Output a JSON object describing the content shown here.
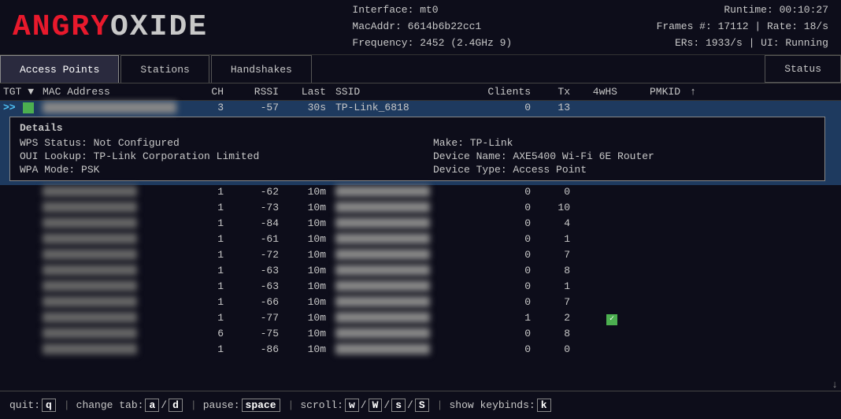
{
  "header": {
    "logo_angry": "ANGRY",
    "logo_oxide": "OXIDE",
    "interface_label": "Interface: mt0",
    "macaddr_label": "MacAddr: 6614b6b22cc1",
    "frequency_label": "Frequency: 2452 (2.4GHz 9)",
    "runtime_label": "Runtime: 00:10:27",
    "frames_label": "Frames #: 17112 | Rate: 18/s",
    "ers_label": "ERs: 1933/s | UI: Running"
  },
  "tabs": [
    {
      "id": "access-points",
      "label": "Access Points",
      "active": true
    },
    {
      "id": "stations",
      "label": "Stations",
      "active": false
    },
    {
      "id": "handshakes",
      "label": "Handshakes",
      "active": false
    },
    {
      "id": "status",
      "label": "Status",
      "active": false
    }
  ],
  "table": {
    "columns": [
      "TGT ▼",
      "MAC Address",
      "CH",
      "RSSI",
      "Last",
      "SSID",
      "Clients",
      "Tx",
      "4wHS",
      "PMKID"
    ],
    "scroll_up": "↑",
    "scroll_down": "↓",
    "selected_row": {
      "indicator": ">>",
      "check": "✓",
      "mac": "██████████",
      "ch": "3",
      "rssi": "-57",
      "last": "30s",
      "ssid": "TP-Link_6818",
      "clients": "0",
      "tx": "13",
      "4whs": "",
      "pmkid": ""
    },
    "details": {
      "title": "Details",
      "wps_status": "WPS Status: Not Configured",
      "oui_lookup": "OUI Lookup: TP-Link Corporation Limited",
      "wpa_mode": "WPA Mode: PSK",
      "make": "Make: TP-Link",
      "device_name": "Device Name: AXE5400 Wi-Fi 6E Router",
      "device_type": "Device Type: Access Point"
    },
    "rows": [
      {
        "ch": "1",
        "rssi": "-62",
        "last": "10m",
        "ssid": "blurred",
        "clients": "0",
        "tx": "0",
        "4whs": "",
        "pmkid": ""
      },
      {
        "ch": "1",
        "rssi": "-73",
        "last": "10m",
        "ssid": "blurred",
        "clients": "0",
        "tx": "10",
        "4whs": "",
        "pmkid": ""
      },
      {
        "ch": "1",
        "rssi": "-84",
        "last": "10m",
        "ssid": "blurred",
        "clients": "0",
        "tx": "4",
        "4whs": "",
        "pmkid": ""
      },
      {
        "ch": "1",
        "rssi": "-61",
        "last": "10m",
        "ssid": "blurred",
        "clients": "0",
        "tx": "1",
        "4whs": "",
        "pmkid": ""
      },
      {
        "ch": "1",
        "rssi": "-72",
        "last": "10m",
        "ssid": "blurred",
        "clients": "0",
        "tx": "7",
        "4whs": "",
        "pmkid": ""
      },
      {
        "ch": "1",
        "rssi": "-63",
        "last": "10m",
        "ssid": "blurred",
        "clients": "0",
        "tx": "8",
        "4whs": "",
        "pmkid": ""
      },
      {
        "ch": "1",
        "rssi": "-63",
        "last": "10m",
        "ssid": "blurred",
        "clients": "0",
        "tx": "1",
        "4whs": "",
        "pmkid": ""
      },
      {
        "ch": "1",
        "rssi": "-66",
        "last": "10m",
        "ssid": "blurred",
        "clients": "0",
        "tx": "7",
        "4whs": "",
        "pmkid": ""
      },
      {
        "ch": "1",
        "rssi": "-77",
        "last": "10m",
        "ssid": "blurred",
        "clients": "1",
        "tx": "2",
        "4whs": "✓",
        "pmkid": ""
      },
      {
        "ch": "6",
        "rssi": "-75",
        "last": "10m",
        "ssid": "blurred",
        "clients": "0",
        "tx": "8",
        "4whs": "",
        "pmkid": ""
      },
      {
        "ch": "1",
        "rssi": "-86",
        "last": "10m",
        "ssid": "blurred",
        "clients": "0",
        "tx": "0",
        "4whs": "",
        "pmkid": ""
      }
    ]
  },
  "statusbar": {
    "quit_label": "quit:",
    "quit_key": "q",
    "changetab_label": "change tab:",
    "changetab_key": "a",
    "changetab_key2": "d",
    "pause_label": "pause:",
    "pause_key": "space",
    "scroll_label": "scroll:",
    "scroll_key1": "w",
    "scroll_key2": "W",
    "scroll_key3": "s",
    "scroll_key4": "S",
    "keybinds_label": "show keybinds:",
    "keybinds_key": "k"
  }
}
